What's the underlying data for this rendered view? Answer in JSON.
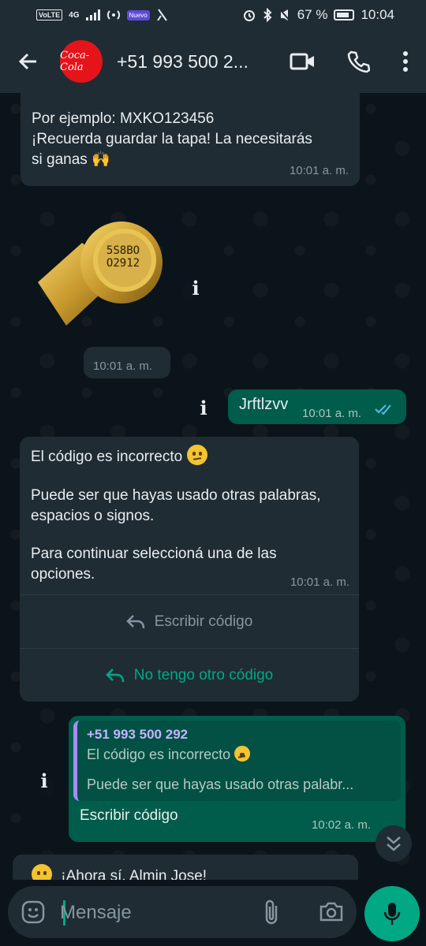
{
  "status_bar": {
    "volte": "VoLTE",
    "network": "4G",
    "app_badge": "Nuevo",
    "battery": "67 %",
    "time": "10:04"
  },
  "app_bar": {
    "contact": "+51 993 500 2...",
    "avatar_text": "Coca-Cola"
  },
  "messages": {
    "m1": {
      "line1": "Por ejemplo: MXKO123456",
      "line2": "¡Recuerda guardar la tapa! La necesitarás",
      "line3": "si ganas 🙌",
      "time": "10:01 a. m."
    },
    "image": {
      "cap_code_1": "5S8BO",
      "cap_code_2": "O2912",
      "time": "10:01 a. m."
    },
    "m2": {
      "text": "Jrftlzvv",
      "time": "10:01 a. m."
    },
    "m3": {
      "line1": "El código es incorrecto",
      "line2": "Puede ser que hayas usado otras palabras,",
      "line3": "espacios o signos.",
      "line4": "Para continuar seleccioná una de las",
      "line5": "opciones.",
      "time": "10:01 a. m.",
      "option1": "Escribir código",
      "option2": "No tengo otro código"
    },
    "m4": {
      "quote_author": "+51 993 500 292",
      "quote_line1": "El código es incorrecto",
      "quote_line2": "Puede ser que hayas usado otras palabr...",
      "text": "Escribir código",
      "time": "10:02 a. m."
    },
    "m5": {
      "text": "¡Ahora sí, Almin Jose!"
    }
  },
  "input": {
    "placeholder": "Mensaje"
  },
  "colors": {
    "incoming": "#1f2c34",
    "outgoing": "#005c4b",
    "accent": "#00a884",
    "background": "#0b141a"
  }
}
